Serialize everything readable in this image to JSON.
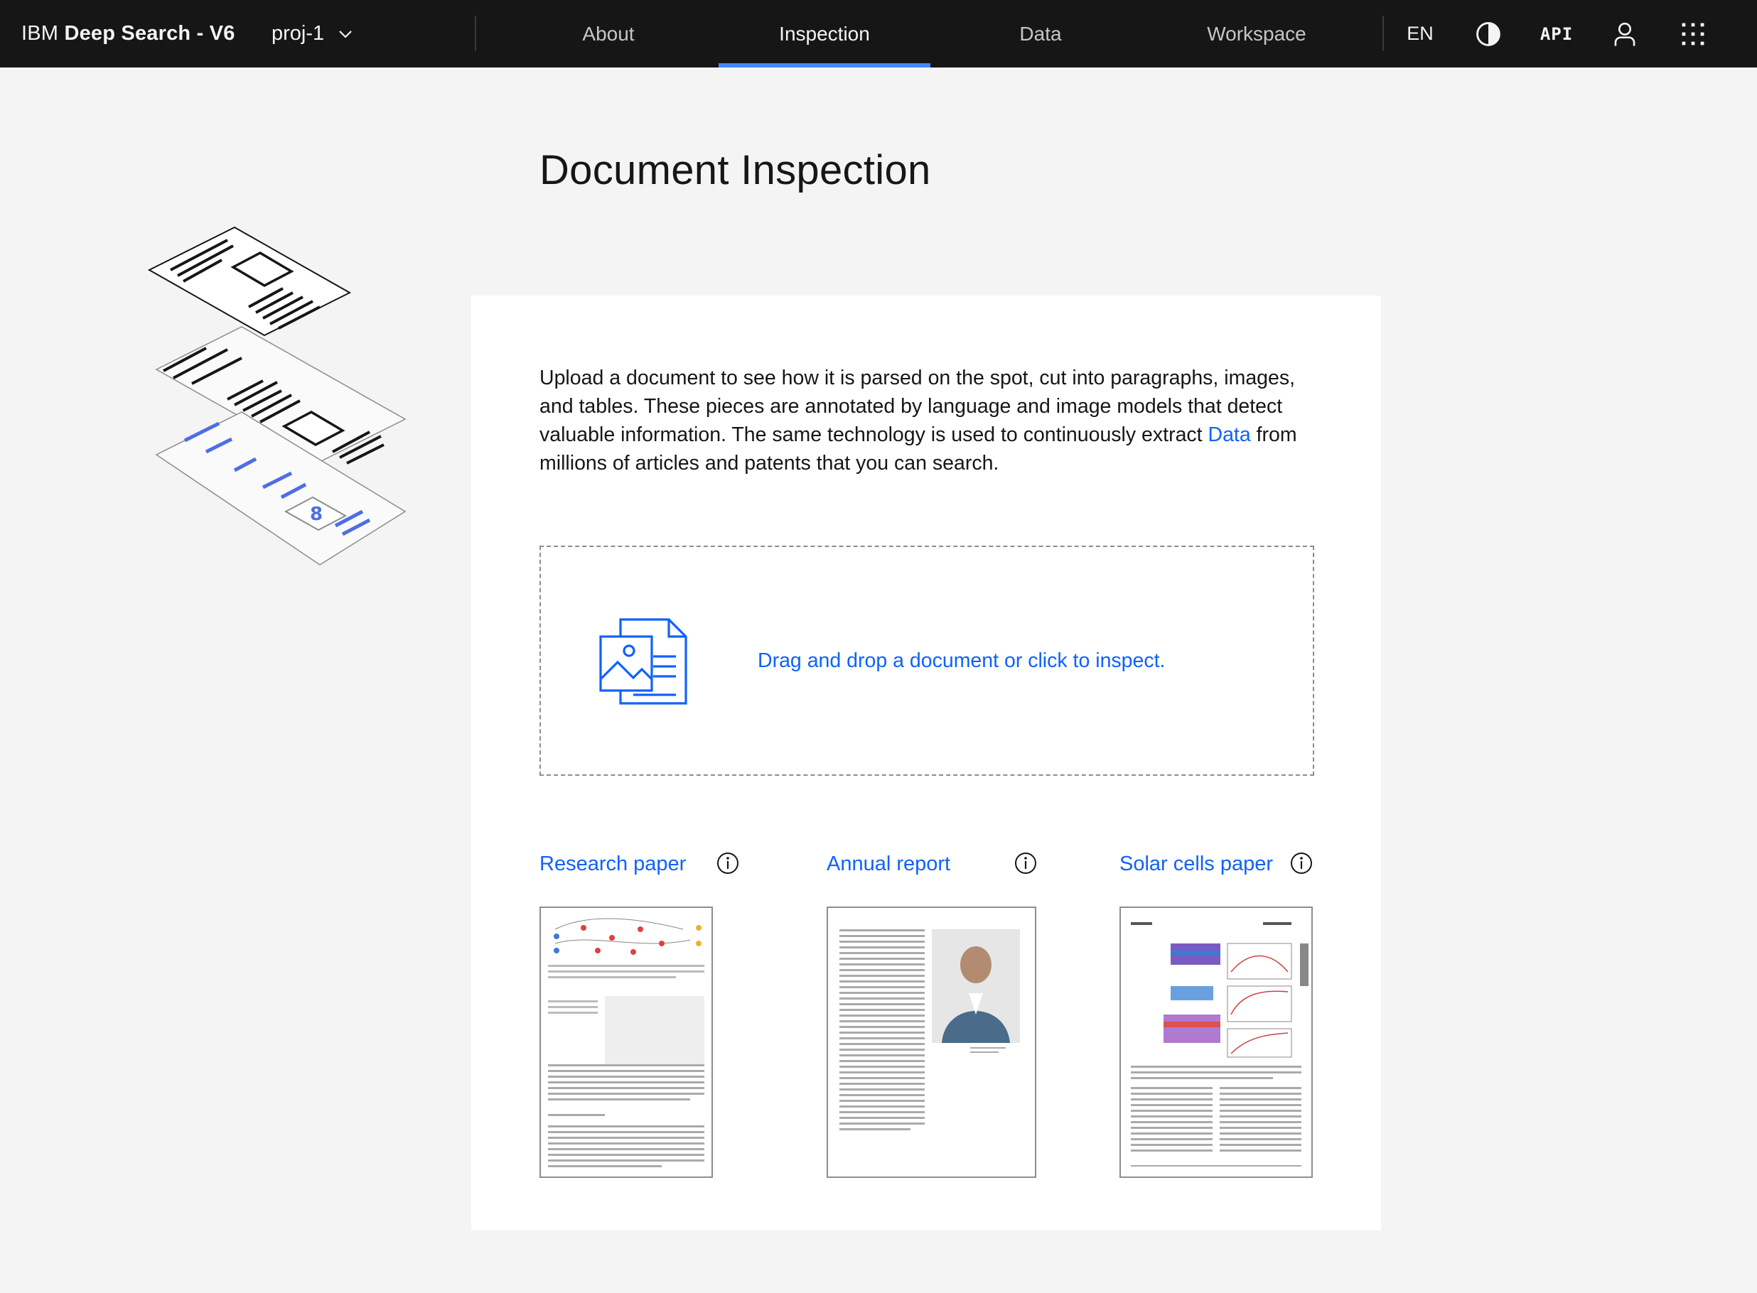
{
  "header": {
    "brand_prefix": "IBM",
    "brand_name": "Deep Search - V6",
    "project": "proj-1",
    "nav": [
      {
        "label": "About",
        "active": false
      },
      {
        "label": "Inspection",
        "active": true
      },
      {
        "label": "Data",
        "active": false
      },
      {
        "label": "Workspace",
        "active": false
      }
    ],
    "language": "EN",
    "api_label": "API",
    "icons": [
      "theme-contrast-icon",
      "user-icon",
      "app-switcher-icon"
    ]
  },
  "page": {
    "title": "Document Inspection"
  },
  "intro": {
    "text_before": "Upload a document to see how it is parsed on the spot, cut into paragraphs, images, and tables. These pieces are annotated by language and image models that detect valuable information. The same technology is used to continuously extract ",
    "link": "Data",
    "text_after": " from millions of articles and patents that you can search."
  },
  "dropzone": {
    "label": "Drag and drop a document or click to inspect."
  },
  "samples": [
    {
      "label": "Research paper"
    },
    {
      "label": "Annual report"
    },
    {
      "label": "Solar cells paper"
    }
  ],
  "colors": {
    "header_bg": "#161616",
    "accent": "#0f62fe",
    "active_tab": "#4589ff",
    "page_bg": "#f4f4f4"
  }
}
